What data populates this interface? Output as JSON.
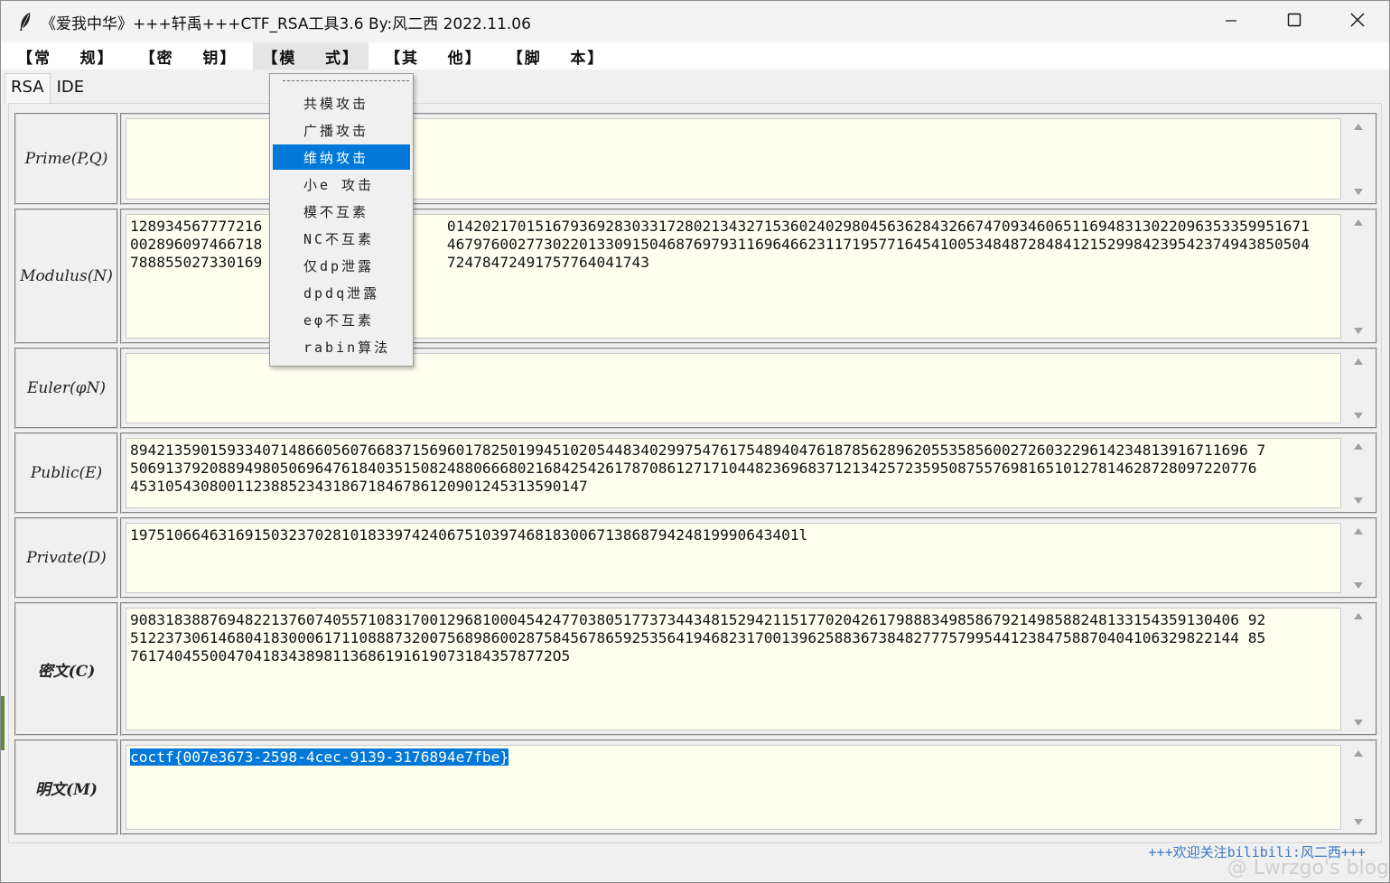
{
  "window": {
    "title": "《爱我中华》+++轩禹+++CTF_RSA工具3.6   By:风二西 2022.11.06",
    "minimize_icon": "minimize-icon",
    "maximize_icon": "maximize-icon",
    "close_icon": "close-icon",
    "app_icon": "feather-icon"
  },
  "menubar": {
    "items": [
      {
        "label": "【常    规】"
      },
      {
        "label": "【密    钥】"
      },
      {
        "label": "【模    式】"
      },
      {
        "label": "【其    他】"
      },
      {
        "label": "【脚    本】"
      }
    ]
  },
  "tabs": [
    {
      "label": "RSA"
    },
    {
      "label": "IDE"
    }
  ],
  "mode_menu": {
    "items": [
      {
        "label": "共模攻击"
      },
      {
        "label": "广播攻击"
      },
      {
        "label": "维纳攻击"
      },
      {
        "label": "小e 攻击"
      },
      {
        "label": "模不互素"
      },
      {
        "label": "NC不互素"
      },
      {
        "label": "仅dp泄露"
      },
      {
        "label": "dpdq泄露"
      },
      {
        "label": "eφ不互素"
      },
      {
        "label": "rabin算法"
      }
    ],
    "highlighted": "维纳攻击"
  },
  "fields": {
    "prime": {
      "label": "Prime(P,Q)",
      "value": ""
    },
    "modulus": {
      "label": "Modulus(N)",
      "value": "128934567777216                     01420217015167936928303317280213432715360240298045636284326674709346065116948313022096353359951671\n002896097466718                     46797600277302201330915046876979311696466231171957716454100534848728484121529984239542374943850504\n788855027330169                     72478472491757764041743"
    },
    "euler": {
      "label": "Euler(φN)",
      "value": ""
    },
    "public": {
      "label": "Public(E)",
      "value": "8942135901593340714866056076683715696017825019945102054483402997547617548940476187856289620553585600272603229614234813916711696 7\n50691379208894980506964761840351508248806668021684254261787086127171044823696837121342572359508755769816510127814628728097220776\n4531054308001123885234318671846786120901245313590147"
    },
    "private": {
      "label": "Private(D)",
      "value": "1975106646316915032370281018339742406751039746818300671386879424819990643401l"
    },
    "cipher": {
      "label": "密文(C)",
      "value": "908318388769482213760740557108317001296810004542477038051773734434815294211517702042617988834985867921498588248133154359130406 92\n512237306146804183000617110888732007568986002875845678659253564194682317001396258836738482777579954412384758870404106329822144 85\n761740455004704183438981136861916190731843578772O5"
    },
    "plain": {
      "label": "明文(M)",
      "value": "coctf{007e3673-2598-4cec-9139-3176894e7fbe}"
    }
  },
  "footer": {
    "credit": "+++欢迎关注bilibili:风二西+++",
    "watermark": "@ Lwrzgo's blog"
  }
}
